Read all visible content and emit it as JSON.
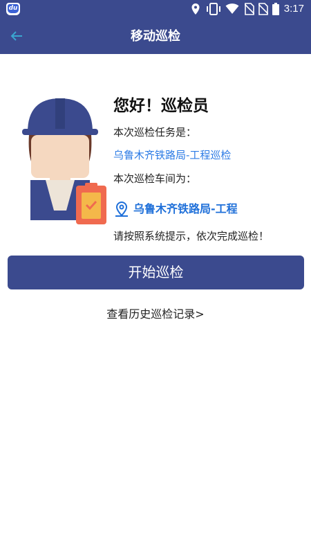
{
  "status_bar": {
    "app_badge": "du",
    "time": "3:17",
    "icons": [
      "location-icon",
      "vibrate-icon",
      "wifi-icon",
      "no-sim-icon",
      "no-sim-icon",
      "battery-icon"
    ]
  },
  "app_bar": {
    "title": "移动巡检",
    "back_icon": "arrow-left-icon"
  },
  "greeting": "您好！巡检员",
  "task_label": "本次巡检任务是：",
  "task_value": "乌鲁木齐铁路局-工程巡检",
  "workshop_label": "本次巡检车间为：",
  "workshop_value": "乌鲁木齐铁路局-工程",
  "hint": "请按照系统提示，依次完成巡检！",
  "start_button": "开始巡检",
  "history_link": "查看历史巡检记录>",
  "colors": {
    "primary": "#3b4a8e",
    "link": "#2c7be5",
    "location": "#1e6fd9"
  }
}
